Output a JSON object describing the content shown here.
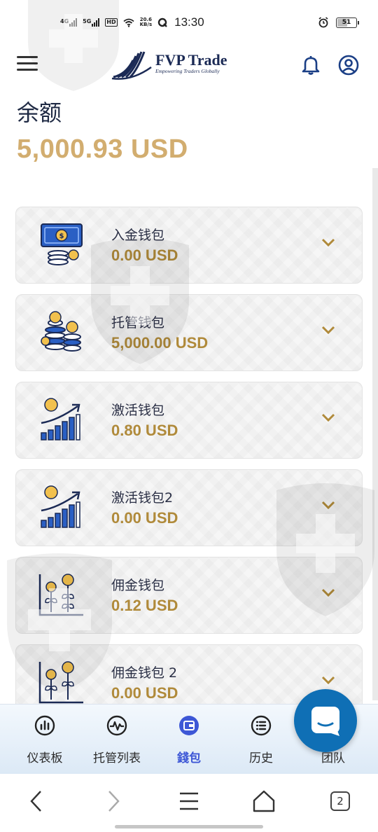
{
  "status_bar": {
    "net1": "4G",
    "net2": "5G",
    "hd": "HD",
    "speed_value": "20.6",
    "speed_unit": "KB/s",
    "time": "13:30",
    "battery": "51"
  },
  "header": {
    "logo_name": "FVP Trade",
    "logo_tagline": "Empowering Traders Globally",
    "icons": [
      "menu-icon",
      "bell-icon",
      "user-icon"
    ]
  },
  "balance": {
    "label": "余额",
    "value": "5,000.93 USD"
  },
  "wallets": [
    {
      "title": "入金钱包",
      "amount": "0.00 USD",
      "icon": "cash-icon"
    },
    {
      "title": "托管钱包",
      "amount": "5,000.00 USD",
      "icon": "coins-stack-icon"
    },
    {
      "title": "激活钱包",
      "amount": "0.80 USD",
      "icon": "growth-chart-icon"
    },
    {
      "title": "激活钱包2",
      "amount": "0.00 USD",
      "icon": "growth-chart-icon"
    },
    {
      "title": "佣金钱包",
      "amount": "0.12 USD",
      "icon": "money-plant-icon"
    },
    {
      "title": "佣金钱包 2",
      "amount": "0.00 USD",
      "icon": "money-plant-icon"
    }
  ],
  "bottom_nav": [
    {
      "label": "仪表板",
      "icon": "dashboard-icon"
    },
    {
      "label": "托管列表",
      "icon": "pulse-icon"
    },
    {
      "label": "錢包",
      "icon": "wallet-icon",
      "active": true
    },
    {
      "label": "历史",
      "icon": "list-icon"
    },
    {
      "label": "团队",
      "icon": "team-icon"
    }
  ],
  "browser": {
    "tab_count": "2"
  },
  "colors": {
    "balance_gold": "#d2ad6f",
    "amount_gold": "#b08a3a",
    "navy": "#1b2a55",
    "active_blue": "#3d57d6",
    "fab_blue": "#0f6fb5"
  }
}
